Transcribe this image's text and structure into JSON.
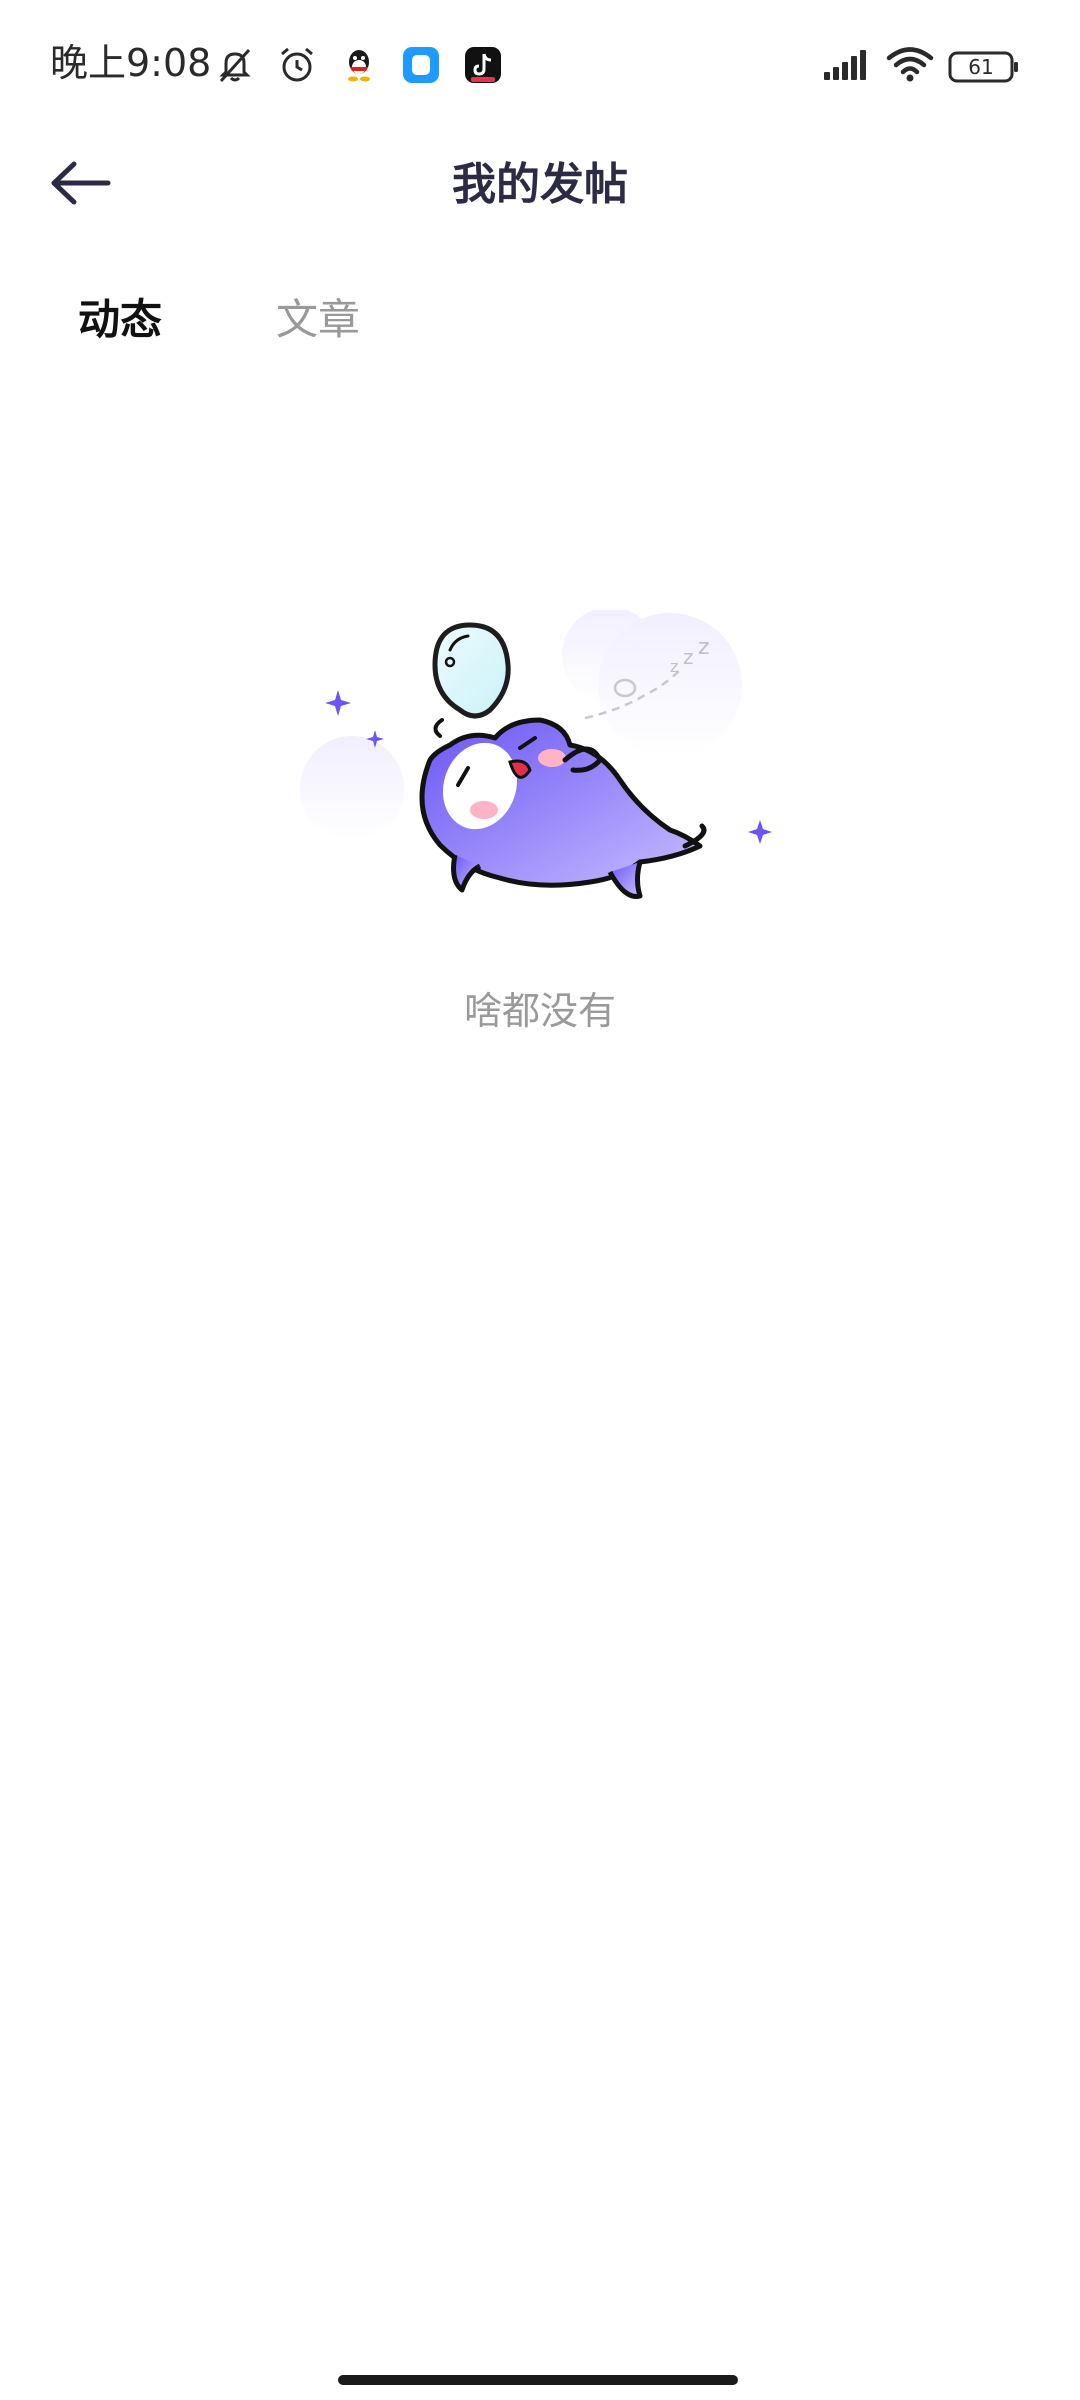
{
  "status_bar": {
    "time": "晚上9:08",
    "battery": "61",
    "icons_left": [
      "mute-notifications-icon",
      "alarm-icon",
      "qq-icon",
      "app-notification-icon",
      "tiktok-icon"
    ],
    "icons_right": [
      "signal-icon",
      "wifi-icon",
      "battery-icon"
    ]
  },
  "header": {
    "title": "我的发帖"
  },
  "tabs": [
    {
      "label": "动态",
      "active": true
    },
    {
      "label": "文章",
      "active": false
    }
  ],
  "empty_state": {
    "message": "啥都没有"
  },
  "colors": {
    "title": "#2b2b45",
    "active_tab": "#111111",
    "inactive_tab": "#999999",
    "accent_purple": "#8b7cff"
  }
}
